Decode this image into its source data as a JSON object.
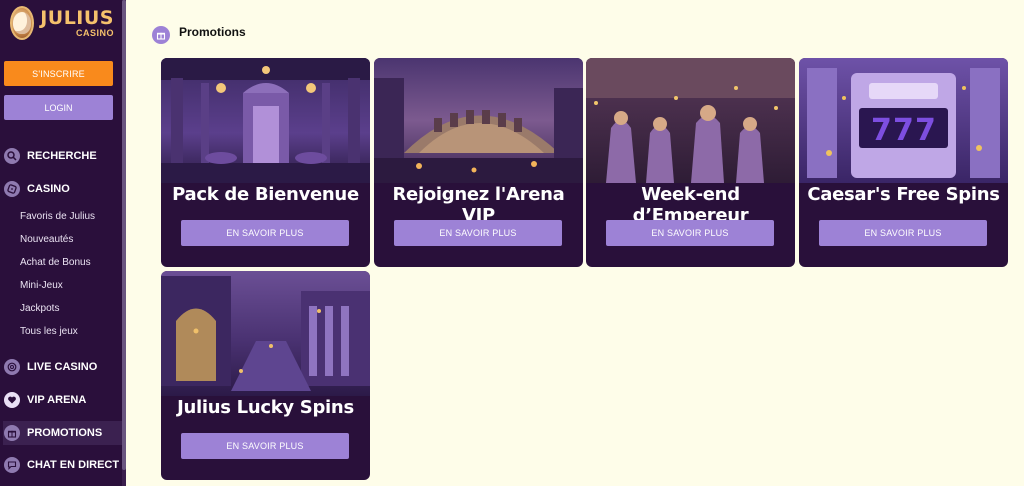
{
  "brand": {
    "name": "JULIUS",
    "sub": "CASINO"
  },
  "auth": {
    "signup_label": "S'INSCRIRE",
    "login_label": "LOGIN"
  },
  "nav": {
    "search": "RECHERCHE",
    "casino": "CASINO",
    "casino_items": [
      "Favoris de Julius",
      "Nouveautés",
      "Achat de Bonus",
      "Mini-Jeux",
      "Jackpots",
      "Tous les jeux"
    ],
    "live_casino": "LIVE CASINO",
    "vip_arena": "VIP ARENA",
    "promotions": "PROMOTIONS",
    "chat": "CHAT EN DIRECT"
  },
  "page": {
    "title": "Promotions"
  },
  "promotions": [
    {
      "title": "Pack de Bienvenue",
      "button": "EN SAVOIR PLUS"
    },
    {
      "title": "Rejoignez l'Arena VIP",
      "button": "EN SAVOIR PLUS"
    },
    {
      "title": "Week-end d’Empereur",
      "button": "EN SAVOIR PLUS"
    },
    {
      "title": "Caesar's Free Spins",
      "button": "EN SAVOIR PLUS"
    },
    {
      "title": "Julius Lucky Spins",
      "button": "EN SAVOIR PLUS"
    }
  ],
  "colors": {
    "sidebar": "#2a0f3b",
    "accent_orange": "#f98a1c",
    "accent_purple": "#9d82d6",
    "page_bg": "#fefde9"
  }
}
